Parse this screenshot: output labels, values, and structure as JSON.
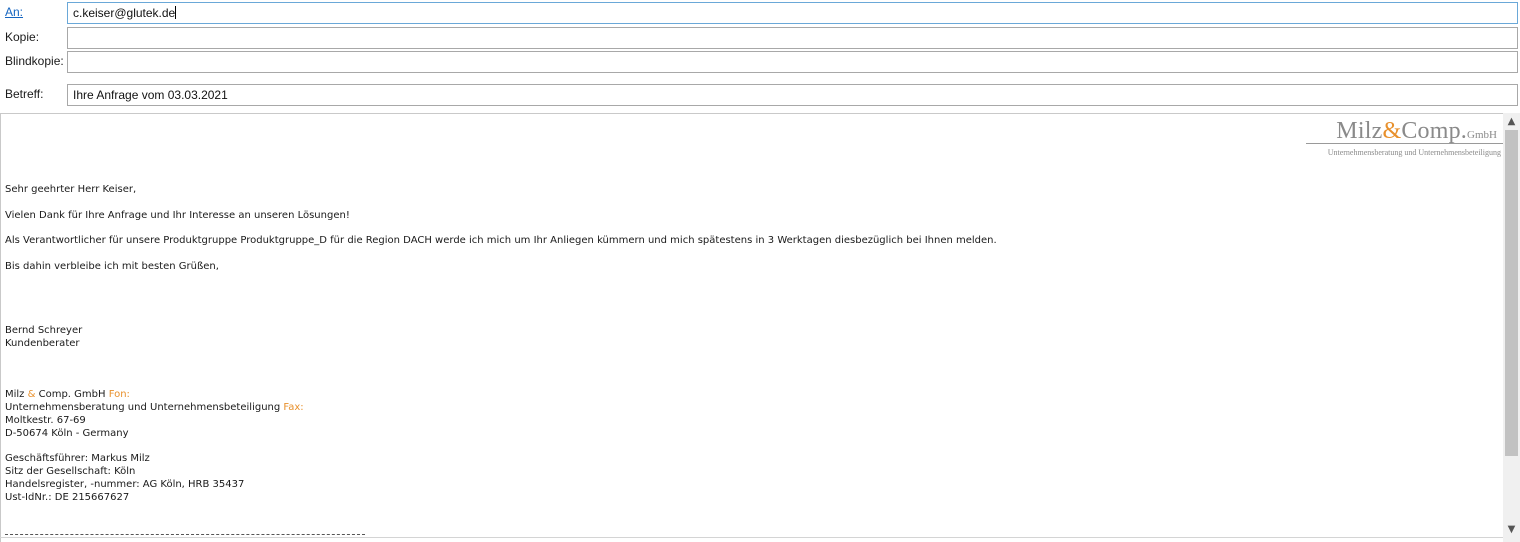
{
  "header": {
    "to": {
      "label": "An:",
      "value": "c.keiser@glutek.de"
    },
    "cc": {
      "label": "Kopie:",
      "value": ""
    },
    "bcc": {
      "label": "Blindkopie:",
      "value": ""
    },
    "subject": {
      "label": "Betreff:",
      "value": "Ihre Anfrage vom 03.03.2021"
    }
  },
  "logo": {
    "name_part1": "Milz",
    "ampersand": "&",
    "name_part2": "Comp.",
    "suffix": "GmbH",
    "tagline": "Unternehmensberatung und Unternehmensbeteiligung"
  },
  "body": {
    "greeting": "Sehr geehrter Herr Keiser,",
    "line1": "Vielen Dank für Ihre Anfrage und Ihr Interesse an unseren Lösungen!",
    "line2": "Als Verantwortlicher für unsere Produktgruppe Produktgruppe_D für die Region DACH werde ich mich um Ihr Anliegen kümmern und mich spätestens in 3 Werktagen diesbezüglich bei Ihnen melden.",
    "closing": "Bis dahin verbleibe ich mit besten Grüßen,"
  },
  "signature": {
    "name": "Bernd Schreyer",
    "role": "Kundenberater",
    "company_a": "Milz ",
    "company_amp": "&",
    "company_b": " Comp. GmbH ",
    "fon_label": "Fon:",
    "division": "Unternehmensberatung und Unternehmensbeteiligung ",
    "fax_label": "Fax:",
    "street": "Moltkestr. 67-69",
    "city": "D-50674 Köln - Germany",
    "ceo": "Geschäftsführer: Markus Milz",
    "seat": "Sitz der Gesellschaft: Köln",
    "register": "Handelsregister, -nummer: AG Köln, HRB 35437",
    "vat": "Ust-IdNr.: DE 215667627"
  },
  "scrollbar": {
    "up_icon": "▲",
    "down_icon": "▼"
  }
}
